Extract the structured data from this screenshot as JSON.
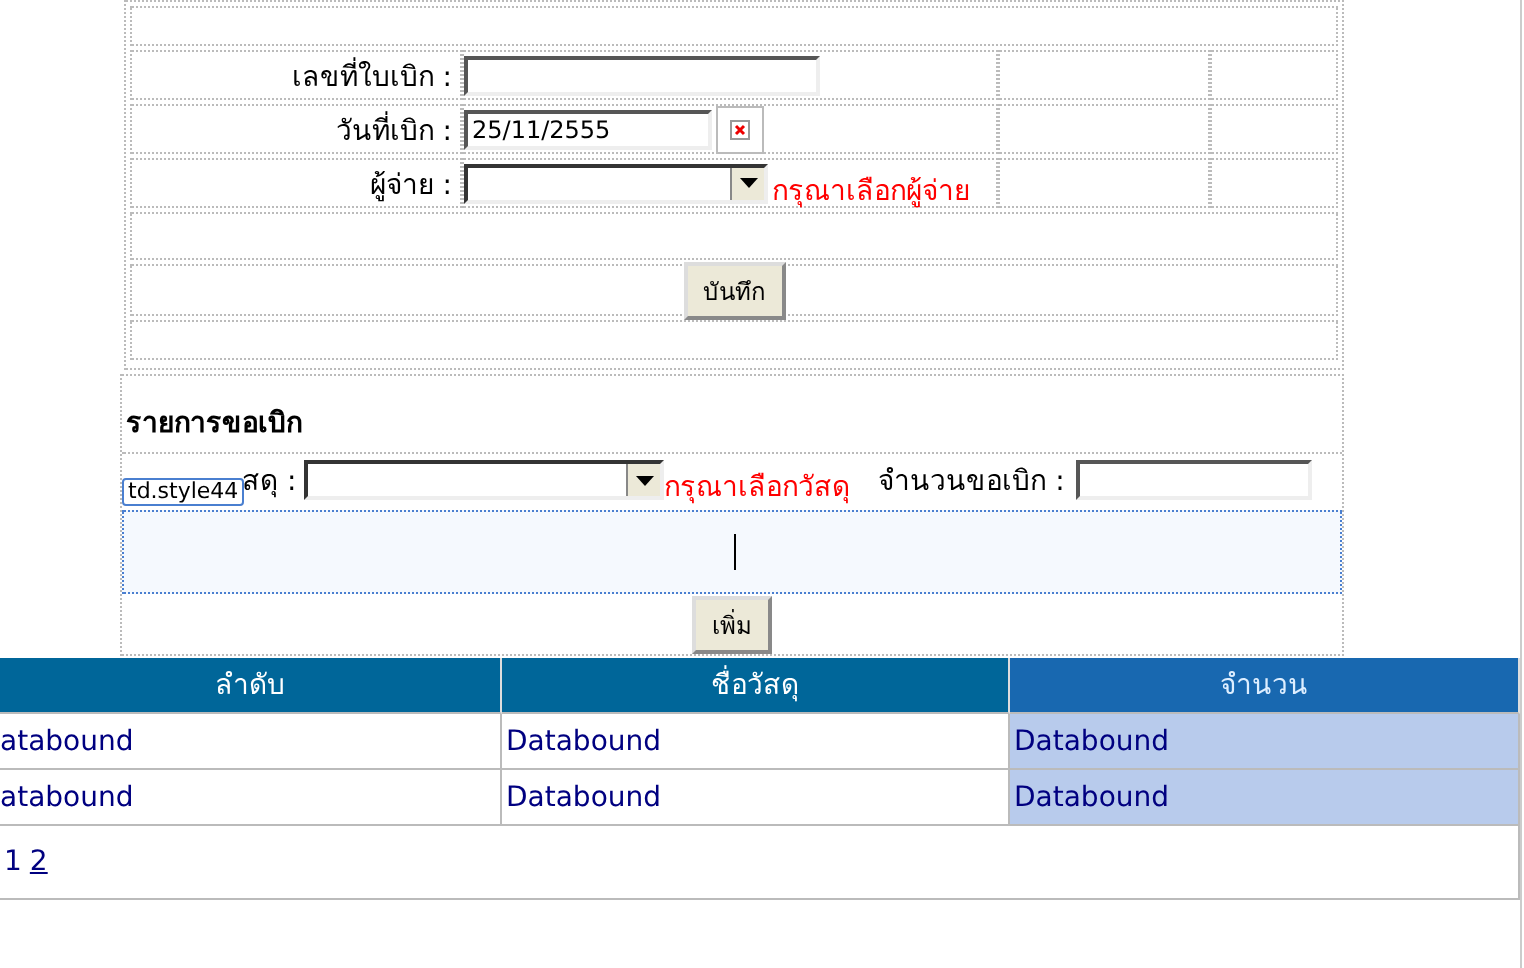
{
  "form": {
    "fields": [
      {
        "kind": "text",
        "label": "เลขที่ใบเบิก :"
      },
      {
        "kind": "date",
        "label": "วันที่เบิก :",
        "value": "25/11/2555"
      },
      {
        "kind": "select",
        "label": "ผู้จ่าย :",
        "validator": "กรุณาเลือกผู้จ่าย"
      }
    ],
    "save_button": "บันทึก"
  },
  "items_section": {
    "title": "รายการขอเบิก",
    "material_label": "สดุ :",
    "material_validator": "กรุณาเลือกวัสดุ",
    "quantity_label": "จำนวนขอเบิก :",
    "selection_tag": "td.style44",
    "add_button": "เพิ่ม"
  },
  "grid": {
    "columns": [
      {
        "label": "ลำดับ",
        "selected": false
      },
      {
        "label": "ชื่อวัสดุ",
        "selected": false
      },
      {
        "label": "จำนวน",
        "selected": true
      }
    ],
    "rows": [
      [
        "atabound",
        "Databound",
        "Databound"
      ],
      [
        "atabound",
        "Databound",
        "Databound"
      ]
    ],
    "pages": [
      {
        "label": "1",
        "selected": true
      },
      {
        "label": "2",
        "selected": false
      }
    ]
  }
}
